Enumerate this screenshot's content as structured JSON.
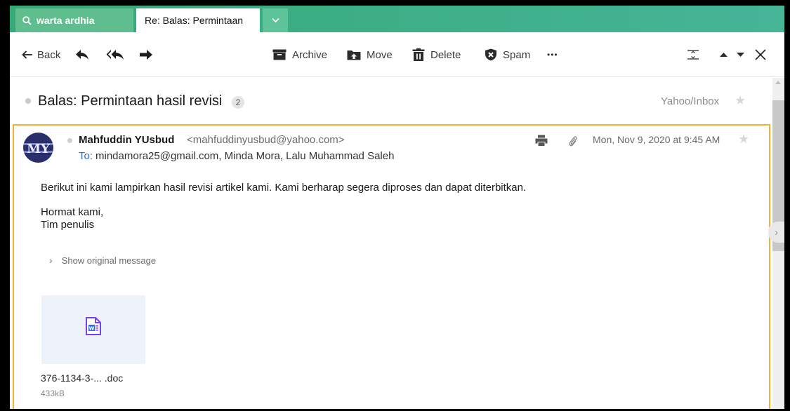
{
  "tabs": {
    "search_label": "warta ardhia",
    "email_label": "Re: Balas: Permintaan"
  },
  "toolbar": {
    "back_label": "Back",
    "archive_label": "Archive",
    "move_label": "Move",
    "delete_label": "Delete",
    "spam_label": "Spam",
    "more_label": "•••"
  },
  "thread": {
    "subject": "Balas: Permintaan hasil revisi",
    "message_count": "2",
    "folder": "Yahoo/Inbox"
  },
  "message": {
    "avatar_text": "MY",
    "sender_name": "Mahfuddin YUsbud",
    "sender_email": "<mahfuddinyusbud@yahoo.com>",
    "to_label": "To:",
    "recipients": "mindamora25@gmail.com,  Minda Mora,  Lalu Muhammad Saleh",
    "date": "Mon, Nov 9, 2020 at 9:45 AM",
    "body_line1": "Berikut ini kami lampirkan hasil revisi artikel kami. Kami berharap segera diproses dan dapat diterbitkan.",
    "body_line2": "Hormat kami,",
    "body_line3": "Tim penulis",
    "show_original_label": "Show original message"
  },
  "attachment": {
    "name": "376-1134-3-... .doc",
    "size": "433kB"
  },
  "colors": {
    "tabbar": "#36a978",
    "selected_border": "#f2b230",
    "link_blue": "#2c6fc7",
    "word_icon": "#7b3ff2"
  }
}
